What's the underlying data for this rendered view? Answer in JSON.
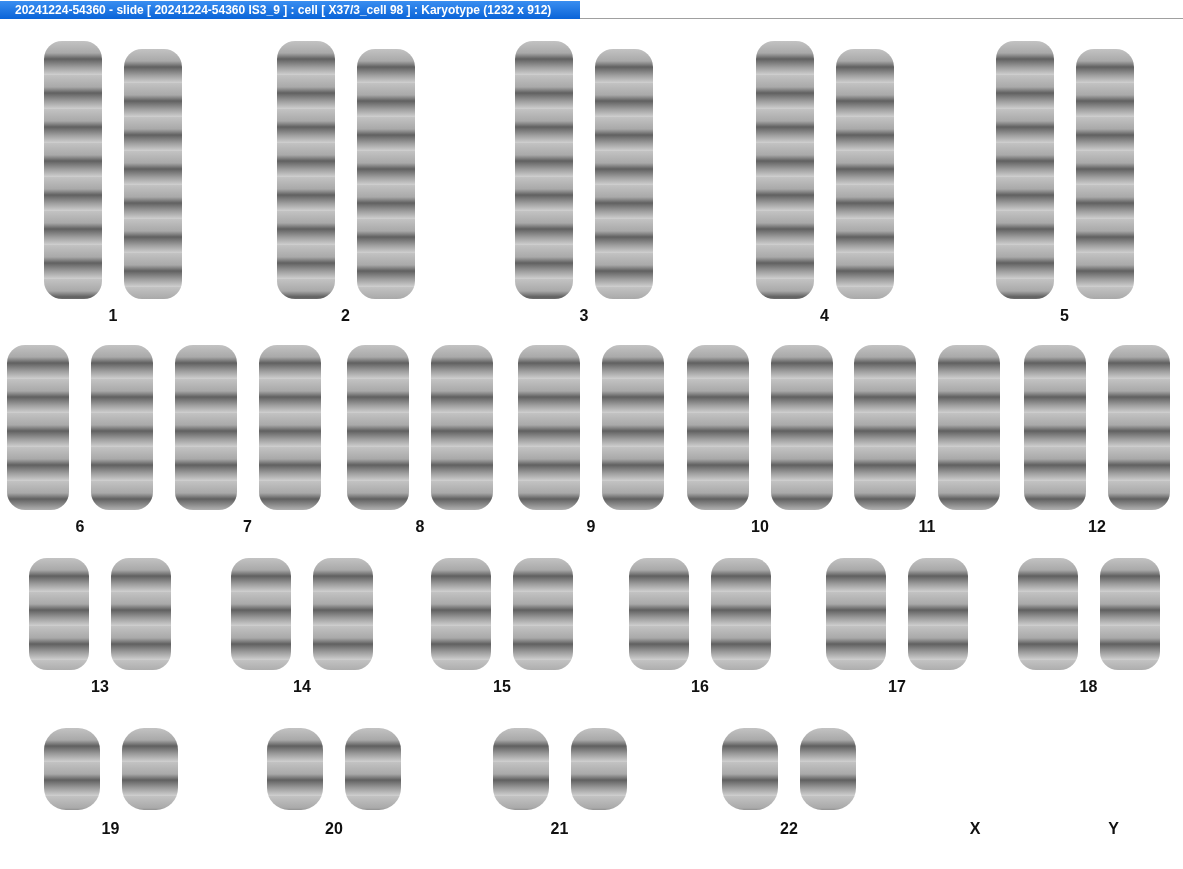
{
  "window": {
    "title": "20241224-54360 - slide [ 20241224-54360 IS3_9 ] : cell [ X37/3_cell 98 ] : Karyotype  (1232 x 912)"
  },
  "karyotype_rows": [
    {
      "groups": [
        {
          "label": "1",
          "kind": "pair"
        },
        {
          "label": "2",
          "kind": "pair"
        },
        {
          "label": "3",
          "kind": "pair"
        },
        {
          "label": "4",
          "kind": "pair"
        },
        {
          "label": "5",
          "kind": "pair"
        }
      ]
    },
    {
      "groups": [
        {
          "label": "6",
          "kind": "pair"
        },
        {
          "label": "7",
          "kind": "pair"
        },
        {
          "label": "8",
          "kind": "pair"
        },
        {
          "label": "9",
          "kind": "pair"
        },
        {
          "label": "10",
          "kind": "pair"
        },
        {
          "label": "11",
          "kind": "pair"
        },
        {
          "label": "12",
          "kind": "pair"
        }
      ]
    },
    {
      "groups": [
        {
          "label": "13",
          "kind": "pair"
        },
        {
          "label": "14",
          "kind": "pair"
        },
        {
          "label": "15",
          "kind": "pair"
        },
        {
          "label": "16",
          "kind": "pair"
        },
        {
          "label": "17",
          "kind": "pair"
        },
        {
          "label": "18",
          "kind": "pair"
        }
      ]
    },
    {
      "groups": [
        {
          "label": "19",
          "kind": "pair"
        },
        {
          "label": "20",
          "kind": "pair"
        },
        {
          "label": "21",
          "kind": "pair"
        },
        {
          "label": "22",
          "kind": "pair"
        },
        {
          "label": "X",
          "kind": "empty"
        },
        {
          "label": "Y",
          "kind": "empty"
        }
      ]
    }
  ]
}
